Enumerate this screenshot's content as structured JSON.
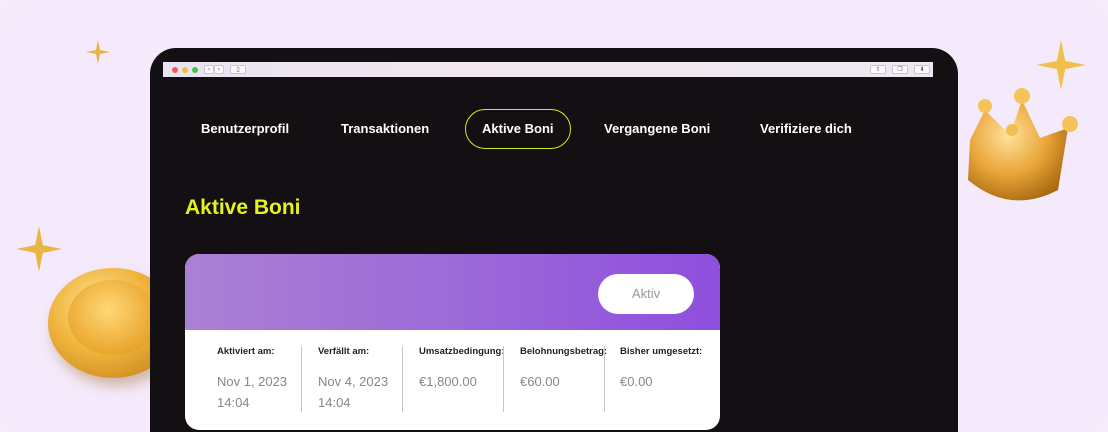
{
  "nav": {
    "items": [
      {
        "label": "Benutzerprofil"
      },
      {
        "label": "Transaktionen"
      },
      {
        "label": "Aktive Boni"
      },
      {
        "label": "Vergangene Boni"
      },
      {
        "label": "Verifiziere dich"
      }
    ],
    "active_index": 2
  },
  "page": {
    "title": "Aktive Boni"
  },
  "bonus_card": {
    "status": "Aktiv",
    "columns": [
      {
        "label": "Aktiviert am:",
        "value": "Nov 1, 2023\n14:04"
      },
      {
        "label": "Verfällt am:",
        "value": "Nov 4, 2023\n14:04"
      },
      {
        "label": "Umsatzbedingung:",
        "value": "€1,800.00"
      },
      {
        "label": "Belohnungsbetrag:",
        "value": "€60.00"
      },
      {
        "label": "Bisher umgesetzt:",
        "value": "€0.00"
      }
    ]
  },
  "colors": {
    "accent": "#e5f21c",
    "header_gradient_start": "#aa80d4",
    "header_gradient_end": "#8e4fdd",
    "screen_bg": "#140f12",
    "page_bg": "#f4eafc"
  },
  "icons": {
    "sparkle": "four-point-star",
    "coin": "gold-coin",
    "crown": "gold-crown"
  }
}
